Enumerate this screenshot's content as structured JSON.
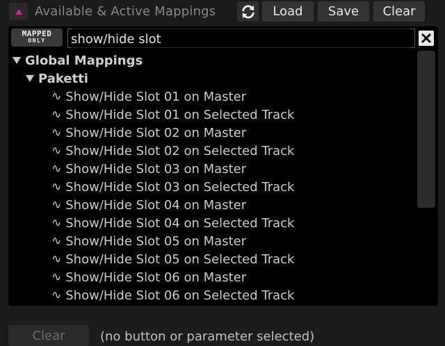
{
  "header": {
    "title": "Available & Active Mappings",
    "load_label": "Load",
    "save_label": "Save",
    "clear_label": "Clear",
    "accent_color": "#e0208a"
  },
  "filter": {
    "mapped_only_line1": "MAPPED",
    "mapped_only_line2": "ONLY",
    "search_value": "show/hide slot"
  },
  "tree": {
    "groups": [
      {
        "label": "Global Mappings",
        "expanded": true
      },
      {
        "label": "Paketti",
        "expanded": true
      }
    ],
    "items_icon": "∿",
    "items": [
      "Show/Hide Slot 01 on Master",
      "Show/Hide Slot 01 on Selected Track",
      "Show/Hide Slot 02 on Master",
      "Show/Hide Slot 02 on Selected Track",
      "Show/Hide Slot 03 on Master",
      "Show/Hide Slot 03 on Selected Track",
      "Show/Hide Slot 04 on Master",
      "Show/Hide Slot 04 on Selected Track",
      "Show/Hide Slot 05 on Master",
      "Show/Hide Slot 05 on Selected Track",
      "Show/Hide Slot 06 on Master",
      "Show/Hide Slot 06 on Selected Track"
    ]
  },
  "footer": {
    "clear_label": "Clear",
    "status": "(no button or parameter selected)"
  }
}
